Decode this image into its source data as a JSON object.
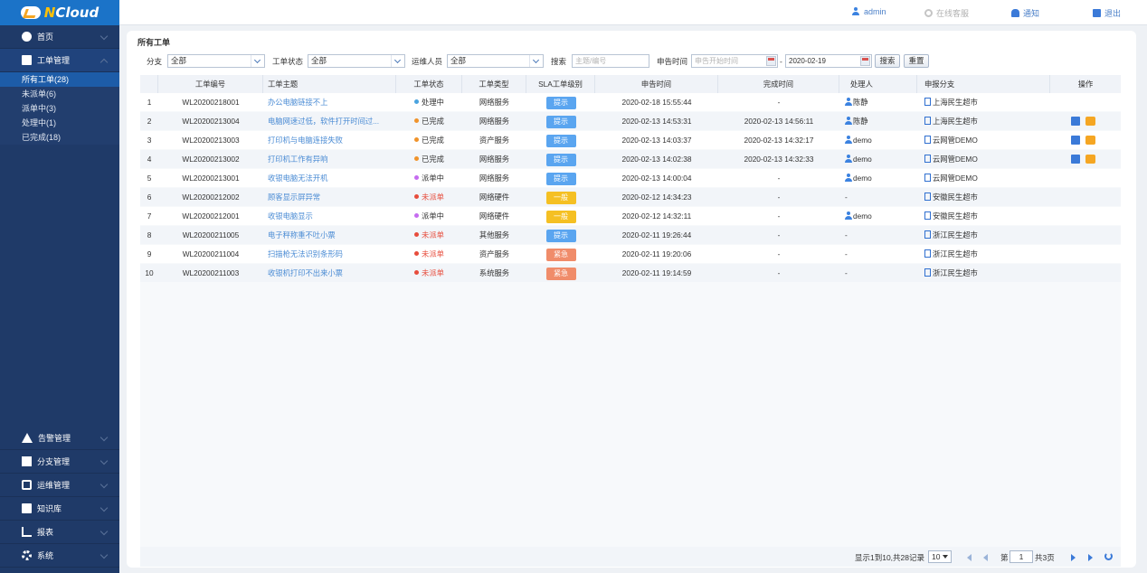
{
  "app": {
    "logo_text": "NCloud"
  },
  "topbar": {
    "user": "admin",
    "support": "在线客服",
    "notify": "通知",
    "logout": "退出"
  },
  "sidebar": {
    "home": "首页",
    "tickets": "工单管理",
    "sub_items": [
      "所有工单(28)",
      "未派单(6)",
      "派单中(3)",
      "处理中(1)",
      "已完成(18)"
    ],
    "bottom": [
      "告警管理",
      "分支管理",
      "运维管理",
      "知识库",
      "报表",
      "系统"
    ]
  },
  "page": {
    "title": "所有工单"
  },
  "filters": {
    "branch_label": "分支",
    "branch_value": "全部",
    "status_label": "工单状态",
    "status_value": "全部",
    "ops_label": "运维人员",
    "ops_value": "全部",
    "search_label": "搜索",
    "search_placeholder": "主题/编号",
    "time_label": "申告时间",
    "start_placeholder": "申告开始时间",
    "sep": "-",
    "end_value": "2020-02-19",
    "search_btn": "搜索",
    "reset_btn": "重置"
  },
  "table": {
    "headers": [
      "工单编号",
      "工单主题",
      "工单状态",
      "工单类型",
      "SLA工单级别",
      "申告时间",
      "完成时间",
      "处理人",
      "申报分支",
      "操作"
    ],
    "rows": [
      {
        "no": "1",
        "id": "WL20200218001",
        "subject": "办公电脑链接不上",
        "status": "处理中",
        "type": "网络服务",
        "sla": "提示",
        "report": "2020-02-18 15:55:44",
        "done": "-",
        "handler": "陈静",
        "branch": "上海民生超市"
      },
      {
        "no": "2",
        "id": "WL20200213004",
        "subject": "电脑网速过低，软件打开时间过...",
        "status": "已完成",
        "type": "网络服务",
        "sla": "提示",
        "report": "2020-02-13 14:53:31",
        "done": "2020-02-13 14:56:11",
        "handler": "陈静",
        "branch": "上海民生超市"
      },
      {
        "no": "3",
        "id": "WL20200213003",
        "subject": "打印机与电脑连接失败",
        "status": "已完成",
        "type": "资产服务",
        "sla": "提示",
        "report": "2020-02-13 14:03:37",
        "done": "2020-02-13 14:32:17",
        "handler": "demo",
        "branch": "云网管DEMO"
      },
      {
        "no": "4",
        "id": "WL20200213002",
        "subject": "打印机工作有异响",
        "status": "已完成",
        "type": "网络服务",
        "sla": "提示",
        "report": "2020-02-13 14:02:38",
        "done": "2020-02-13 14:32:33",
        "handler": "demo",
        "branch": "云网管DEMO"
      },
      {
        "no": "5",
        "id": "WL20200213001",
        "subject": "收银电脑无法开机",
        "status": "派单中",
        "type": "网络服务",
        "sla": "提示",
        "report": "2020-02-13 14:00:04",
        "done": "-",
        "handler": "demo",
        "branch": "云网管DEMO"
      },
      {
        "no": "6",
        "id": "WL20200212002",
        "subject": "顾客显示屏异常",
        "status": "未派单",
        "type": "网络硬件",
        "sla": "一般",
        "report": "2020-02-12 14:34:23",
        "done": "-",
        "handler": "-",
        "branch": "安徽民生超市"
      },
      {
        "no": "7",
        "id": "WL20200212001",
        "subject": "收银电脑显示",
        "status": "派单中",
        "type": "网络硬件",
        "sla": "一般",
        "report": "2020-02-12 14:32:11",
        "done": "-",
        "handler": "demo",
        "branch": "安徽民生超市"
      },
      {
        "no": "8",
        "id": "WL20200211005",
        "subject": "电子秤称重不吐小票",
        "status": "未派单",
        "type": "其他服务",
        "sla": "提示",
        "report": "2020-02-11 19:26:44",
        "done": "-",
        "handler": "-",
        "branch": "浙江民生超市"
      },
      {
        "no": "9",
        "id": "WL20200211004",
        "subject": "扫描枪无法识别条形码",
        "status": "未派单",
        "type": "资产服务",
        "sla": "紧急",
        "report": "2020-02-11 19:20:06",
        "done": "-",
        "handler": "-",
        "branch": "浙江民生超市"
      },
      {
        "no": "10",
        "id": "WL20200211003",
        "subject": "收银机打印不出来小票",
        "status": "未派单",
        "type": "系统服务",
        "sla": "紧急",
        "report": "2020-02-11 19:14:59",
        "done": "-",
        "handler": "-",
        "branch": "浙江民生超市"
      }
    ]
  },
  "pager": {
    "info": "显示1到10,共28记录",
    "page_size": "10",
    "page_prefix": "第",
    "page_value": "1",
    "page_total": "共3页"
  },
  "colors": {
    "status": {
      "处理中": "#4aa3df",
      "已完成": "#f0932b",
      "派单中": "#c56cf0",
      "未派单": "#e74c3c"
    },
    "sla": {
      "提示": "#5aa5f0",
      "一般": "#f5c023",
      "紧急": "#f08c6a"
    }
  }
}
